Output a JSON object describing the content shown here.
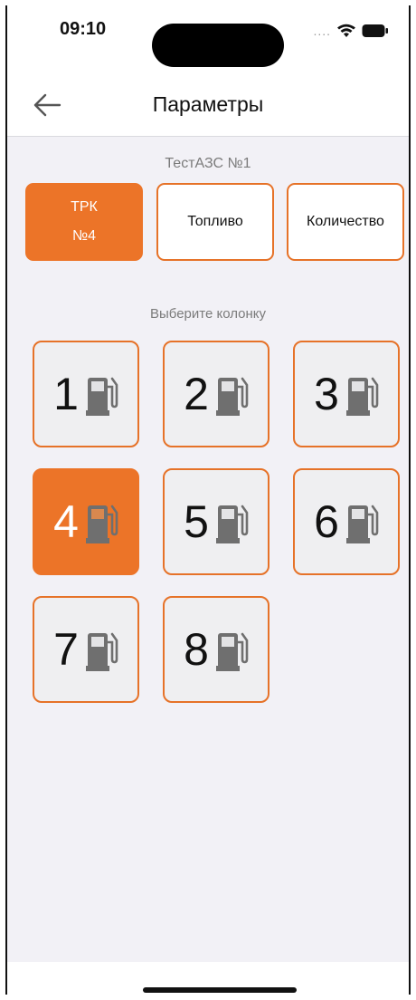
{
  "status_bar": {
    "time": "09:10",
    "icons": [
      "cellular-dots-icon",
      "wifi-icon",
      "battery-icon"
    ]
  },
  "header": {
    "title": "Параметры",
    "back_icon": "back-arrow-icon"
  },
  "station_name": "ТестАЗС №1",
  "tabs": [
    {
      "line1": "ТРК",
      "line2": "№4",
      "active": true
    },
    {
      "label": "Топливо",
      "active": false
    },
    {
      "label": "Количество",
      "active": false
    }
  ],
  "pumps_prompt": "Выберите колонку",
  "pumps": [
    {
      "number": "1",
      "selected": false
    },
    {
      "number": "2",
      "selected": false
    },
    {
      "number": "3",
      "selected": false
    },
    {
      "number": "4",
      "selected": true
    },
    {
      "number": "5",
      "selected": false
    },
    {
      "number": "6",
      "selected": false
    },
    {
      "number": "7",
      "selected": false
    },
    {
      "number": "8",
      "selected": false
    }
  ],
  "pump_icon": "fuel-pump-icon",
  "colors": {
    "accent": "#ec7428",
    "background": "#f2f1f6",
    "pump_icon": "#6f6f6f"
  }
}
